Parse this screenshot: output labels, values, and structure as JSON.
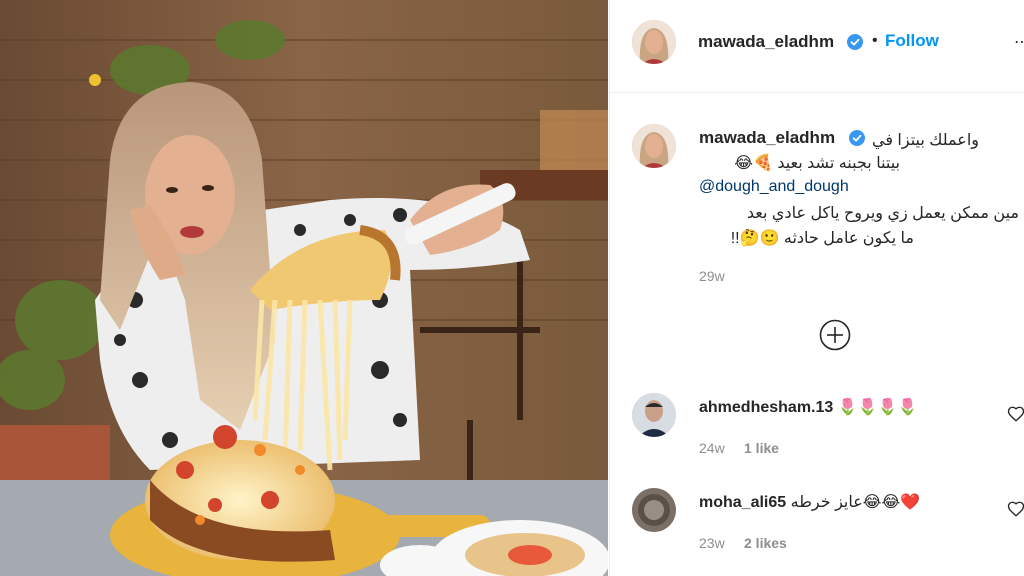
{
  "post": {
    "username": "mawada_eladhm",
    "follow_label": "Follow",
    "separator": "•",
    "more_label": "⋯",
    "caption": {
      "line1": "واعملك بيتزا في",
      "line2": "بيتنا بجبنه تشد بعيد 🍕😂",
      "mention": "@dough_and_dough",
      "line3": "مين ممكن يعمل زي ويروح ياكل عادي بعد",
      "line4": "ما يكون عامل حادثه 🙂🤔!!",
      "time": "29w"
    }
  },
  "comments": [
    {
      "username": "ahmedhesham.13",
      "text": "🌷🌷🌷🌷",
      "time": "24w",
      "likes": "1 like"
    },
    {
      "username": "moha_ali65",
      "text": "عايز خرطه😂😂❤️",
      "time": "23w",
      "likes": "2 likes"
    }
  ],
  "colors": {
    "follow": "#0095f6",
    "verified": "#3897f0",
    "mention": "#00376b",
    "muted": "#8e8e8e"
  },
  "icons": {
    "verified": "verified-badge-icon",
    "load_more": "plus-circle-icon",
    "like": "heart-icon"
  }
}
